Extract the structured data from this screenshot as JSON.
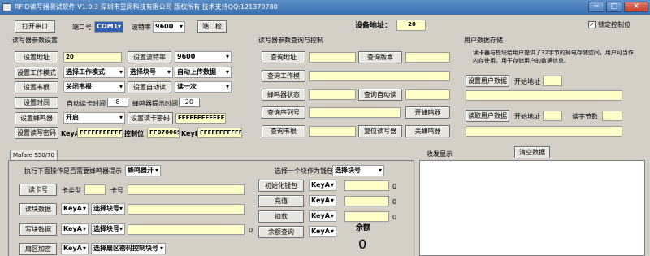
{
  "window": {
    "title": "RFID读写器测试软件 V1.0.3     深圳市昱闵科技有限公司   版权所有   技术支持QQ:121379780",
    "minimize": "─",
    "maximize": "□",
    "close": "✕"
  },
  "top": {
    "open_port": "打开串口",
    "port_label": "端口号",
    "port_value": "COM1",
    "baud_label": "波特率",
    "baud_value": "9600",
    "port_check": "端口检",
    "device_addr_label": "设备地址：",
    "device_addr_value": "20",
    "lock_control": "锁定控制位",
    "lock_checked": "✓"
  },
  "reader_settings": {
    "title": "读写器参数设置",
    "set_addr": "设置地址",
    "addr_value": "20",
    "set_baud": "设置波特率",
    "baud_value": "9600",
    "set_mode": "设置工作模式",
    "mode_value": "选择工作模式",
    "block_value": "选择块号",
    "upload_value": "自动上传数据",
    "set_rootid": "设置韦根",
    "rootid_value": "关闭韦根",
    "set_autoread": "设置自动读",
    "autoread_value": "读一次",
    "set_time": "设置时间",
    "autoread_time_label": "自动读卡时间",
    "autoread_time_value": "8",
    "buzzer_time_label": "蜂鸣器提示时间",
    "buzzer_time_value": "20",
    "set_buzzer": "设置蜂鸣器",
    "buzzer_value": "开启",
    "set_default_pwd": "设置读卡密码",
    "default_pwd_value": "FFFFFFFFFFFF",
    "set_rw_pwd": "设置读写密码",
    "keya_label": "KeyA",
    "keya_value": "FFFFFFFFFFFF",
    "ctrl_label": "控制位",
    "ctrl_value": "FF078069",
    "keyb_label": "KeyB",
    "keyb_value": "FFFFFFFFFFFF"
  },
  "query": {
    "title": "读写器参数查询与控制",
    "query_addr": "查询地址",
    "query_version": "查询版本",
    "query_mode": "查询工作模",
    "buzzer_status": "蜂鸣器状态",
    "query_autoread": "查询自动读",
    "query_serial": "查询序列号",
    "open_buzzer": "开蜂鸣器",
    "query_rootid": "查询韦根",
    "reset_reader": "复位读写器",
    "close_buzzer": "关蜂鸣器"
  },
  "user_data": {
    "title": "用户数据存储",
    "desc": "读卡器与模块给用户提供了32字节的掉电存储空间，用户可当作内存使用。用于存储用户的数据信息。",
    "set_data": "设置用户数据",
    "start_addr_label": "开始地址",
    "read_data": "读取用户数据",
    "start_addr_label2": "开始地址",
    "bytes_label": "读字节数"
  },
  "tabs": {
    "mifare": "Mafare S50/70"
  },
  "mifare": {
    "buzzer_prompt_label": "执行下面操作是否需要蜂鸣器提示",
    "buzzer_prompt_value": "蜂鸣器开",
    "read_card_no": "读卡号",
    "card_type_label": "卡类型",
    "card_no_label": "卡号",
    "read_data": "读块数据",
    "keya": "KeyA",
    "block_select": "选择块号",
    "write_data": "写块数据",
    "zero_write": "0",
    "sector_encrypt": "扇区加密",
    "sector_select": "选择扇区密码控制块号",
    "wallet_label": "选择一个块作为钱包",
    "wallet_block": "选择块号",
    "init_wallet": "初始化钱包",
    "recharge": "充值",
    "deduct": "扣款",
    "balance_query": "余额查询",
    "zero_init": "0",
    "zero_recharge": "0",
    "zero_deduct": "0",
    "balance_label": "余额",
    "balance_value": "0"
  },
  "transceive": {
    "title": "收发显示",
    "clear": "清空数据"
  }
}
